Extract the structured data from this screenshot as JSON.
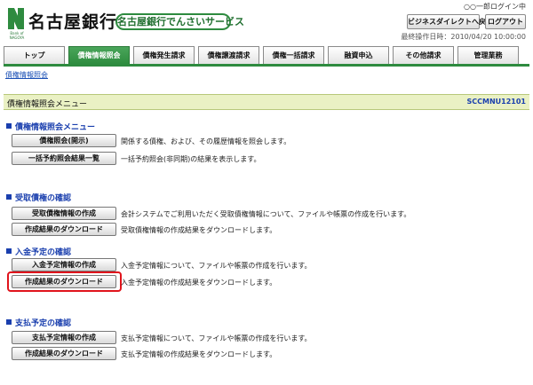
{
  "header": {
    "bank_name": "名古屋銀行",
    "logo_sub": "Bank of NAGOYA",
    "service_name": "名古屋銀行でんさいサービス",
    "login_status": "○○一郎ログイン中",
    "direct_button": "ビジネスダイレクトへ戻る",
    "logout_button": "ログアウト",
    "last_operation": "最終操作日時：2010/04/20 10:00:00"
  },
  "tabs": [
    {
      "label": "トップ",
      "active": false
    },
    {
      "label": "債権情報照会",
      "active": true
    },
    {
      "label": "債権発生請求",
      "active": false
    },
    {
      "label": "債権譲渡請求",
      "active": false
    },
    {
      "label": "債権一括請求",
      "active": false
    },
    {
      "label": "融資申込",
      "active": false
    },
    {
      "label": "その他請求",
      "active": false
    },
    {
      "label": "管理業務",
      "active": false
    }
  ],
  "breadcrumb": "債権情報照会",
  "screen": {
    "title": "債権情報照会メニュー",
    "id": "SCCMNU12101"
  },
  "sections": [
    {
      "heading": "債権情報照会メニュー",
      "rows": [
        {
          "button": "債権照会(開示)",
          "description": "関係する債権、および、その履歴情報を照会します。"
        },
        {
          "button": "一括予約照会結果一覧",
          "description": "一括予約照会(非同期)の結果を表示します。"
        }
      ]
    },
    {
      "heading": "受取債権の確認",
      "rows": [
        {
          "button": "受取債権情報の作成",
          "description": "会計システムでご利用いただく受取債権情報について、ファイルや帳票の作成を行います。"
        },
        {
          "button": "作成結果のダウンロード",
          "description": "受取債権情報の作成結果をダウンロードします。"
        }
      ]
    },
    {
      "heading": "入金予定の確認",
      "rows": [
        {
          "button": "入金予定情報の作成",
          "description": "入金予定情報について、ファイルや帳票の作成を行います。"
        },
        {
          "button": "作成結果のダウンロード",
          "description": "入金予定情報の作成結果をダウンロードします。"
        }
      ]
    },
    {
      "heading": "支払予定の確認",
      "rows": [
        {
          "button": "支払予定情報の作成",
          "description": "支払予定情報について、ファイルや帳票の作成を行います。"
        },
        {
          "button": "作成結果のダウンロード",
          "description": "支払予定情報の作成結果をダウンロードします。"
        }
      ]
    }
  ],
  "colors": {
    "brand_green": "#2e8b3f",
    "heading_blue": "#1a3fae",
    "title_bar_bg": "#eaf1c4",
    "highlight_red": "#e0141c"
  },
  "icons": {
    "logo": "nagoya-bank-logo-icon",
    "section_marker": "square-bullet-icon"
  }
}
